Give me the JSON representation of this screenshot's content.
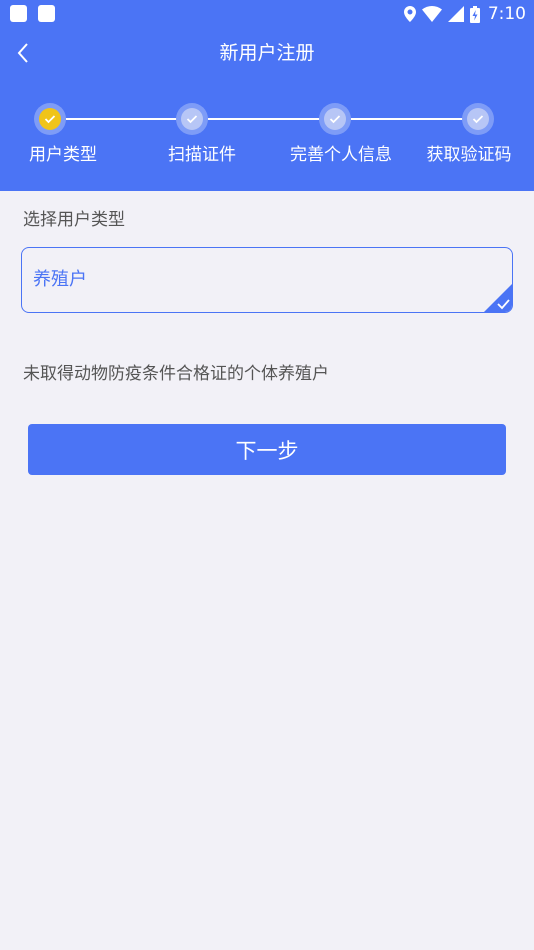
{
  "status_bar": {
    "time": "7:10",
    "icons": [
      "notification-icon",
      "notification-icon",
      "location-icon",
      "wifi-icon",
      "signal-icon",
      "battery-icon"
    ]
  },
  "header": {
    "title": "新用户注册",
    "back_icon": "chevron-left-icon"
  },
  "steps": [
    {
      "label": "用户类型",
      "state": "active"
    },
    {
      "label": "扫描证件",
      "state": "pending"
    },
    {
      "label": "完善个人信息",
      "state": "pending"
    },
    {
      "label": "获取验证码",
      "state": "pending"
    }
  ],
  "form": {
    "section_label": "选择用户类型",
    "selected_type": "养殖户",
    "description": "未取得动物防疫条件合格证的个体养殖户"
  },
  "next_button_label": "下一步",
  "colors": {
    "primary": "#4b74f5",
    "active_step": "#f0c419",
    "background": "#f2f1f7"
  }
}
